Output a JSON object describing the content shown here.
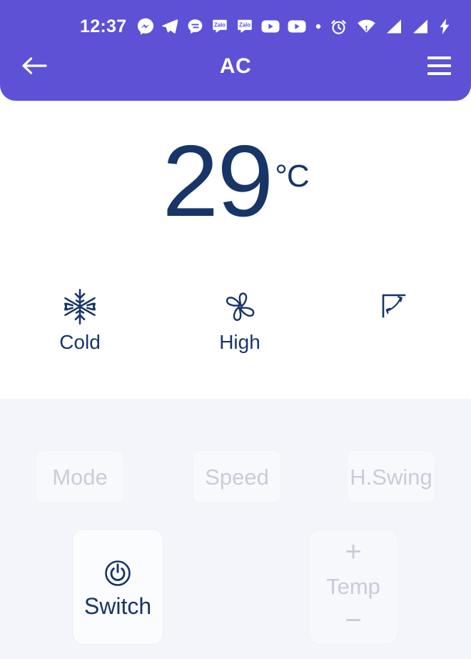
{
  "status_bar": {
    "time": "12:37",
    "left_icons": [
      {
        "name": "messenger-icon",
        "label": "Messenger"
      },
      {
        "name": "telegram-icon",
        "label": "Telegram"
      },
      {
        "name": "chat-bubble-icon",
        "label": "Chat"
      },
      {
        "name": "zalo-icon",
        "label": "Zalo"
      },
      {
        "name": "zalo-icon",
        "label": "Zalo"
      },
      {
        "name": "youtube-icon",
        "label": "YouTube"
      },
      {
        "name": "youtube-icon",
        "label": "YouTube"
      },
      {
        "name": "more-dot-icon",
        "label": "More"
      }
    ],
    "right_icons": [
      {
        "name": "alarm-clock-icon",
        "label": "Alarm"
      },
      {
        "name": "wifi-icon",
        "label": "Wi-Fi"
      },
      {
        "name": "signal-bars-icon",
        "label": "Signal 1"
      },
      {
        "name": "signal-bars-icon",
        "label": "Signal 2"
      },
      {
        "name": "battery-charging-icon",
        "label": "Charging"
      }
    ]
  },
  "nav_bar": {
    "title": "AC",
    "back_icon": "back-arrow-icon",
    "menu_icon": "hamburger-menu-icon"
  },
  "display": {
    "temperature": "29",
    "unit": "°C",
    "status_items": [
      {
        "icon": "snowflake-icon",
        "label": "Cold"
      },
      {
        "icon": "fan-icon",
        "label": "High"
      },
      {
        "icon": "swing-angle-icon",
        "label": ""
      }
    ]
  },
  "controls": {
    "selectors": [
      {
        "label": "Mode",
        "name": "mode-button"
      },
      {
        "label": "Speed",
        "name": "speed-button"
      },
      {
        "label": "H.Swing",
        "name": "h-swing-button"
      }
    ],
    "switch": {
      "label": "Switch",
      "icon": "power-icon"
    },
    "temp_stepper": {
      "plus": "+",
      "label": "Temp",
      "minus": "−"
    }
  },
  "colors": {
    "header_purple": "#5d51d6",
    "navy": "#173567",
    "panel_bg": "#f4f5fa",
    "muted_text": "#c9ccd9",
    "white": "#ffffff"
  }
}
